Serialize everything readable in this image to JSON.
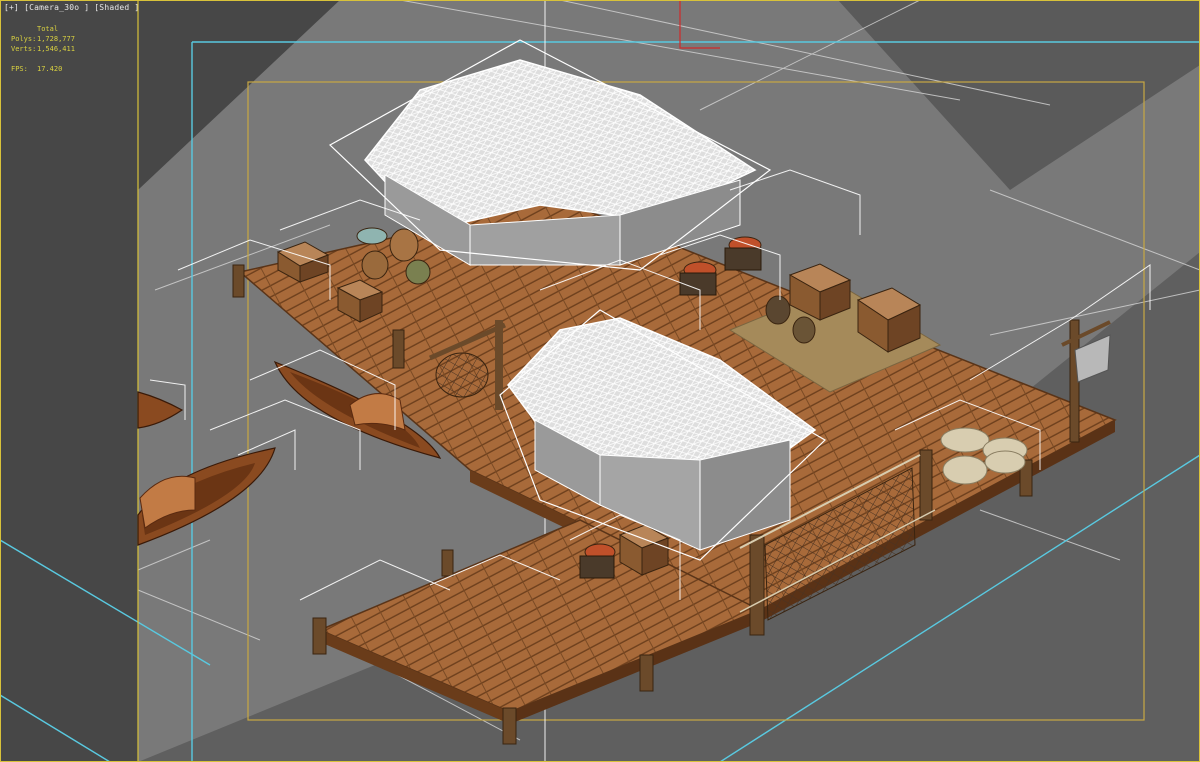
{
  "viewport": {
    "label": "[+] [Camera_30o ] [Shaded ]",
    "stats": {
      "header": "Total",
      "polys_label": "Polys:",
      "polys_value": "1,728,777",
      "verts_label": "Verts:",
      "verts_value": "1,546,411",
      "fps_label": "FPS:",
      "fps_value": "17.420"
    }
  },
  "colors": {
    "viewport_bg": "#5f5f5f",
    "ground_plane": "#7a7a7a",
    "left_panel": "#474747",
    "grid_cyan": "#59c9e0",
    "frame_gold": "#c9a843",
    "wood_plank": "#a86a3a",
    "wireframe": "#ffffff",
    "selection_red": "#d02a2a",
    "stats_text": "#d8d040"
  }
}
